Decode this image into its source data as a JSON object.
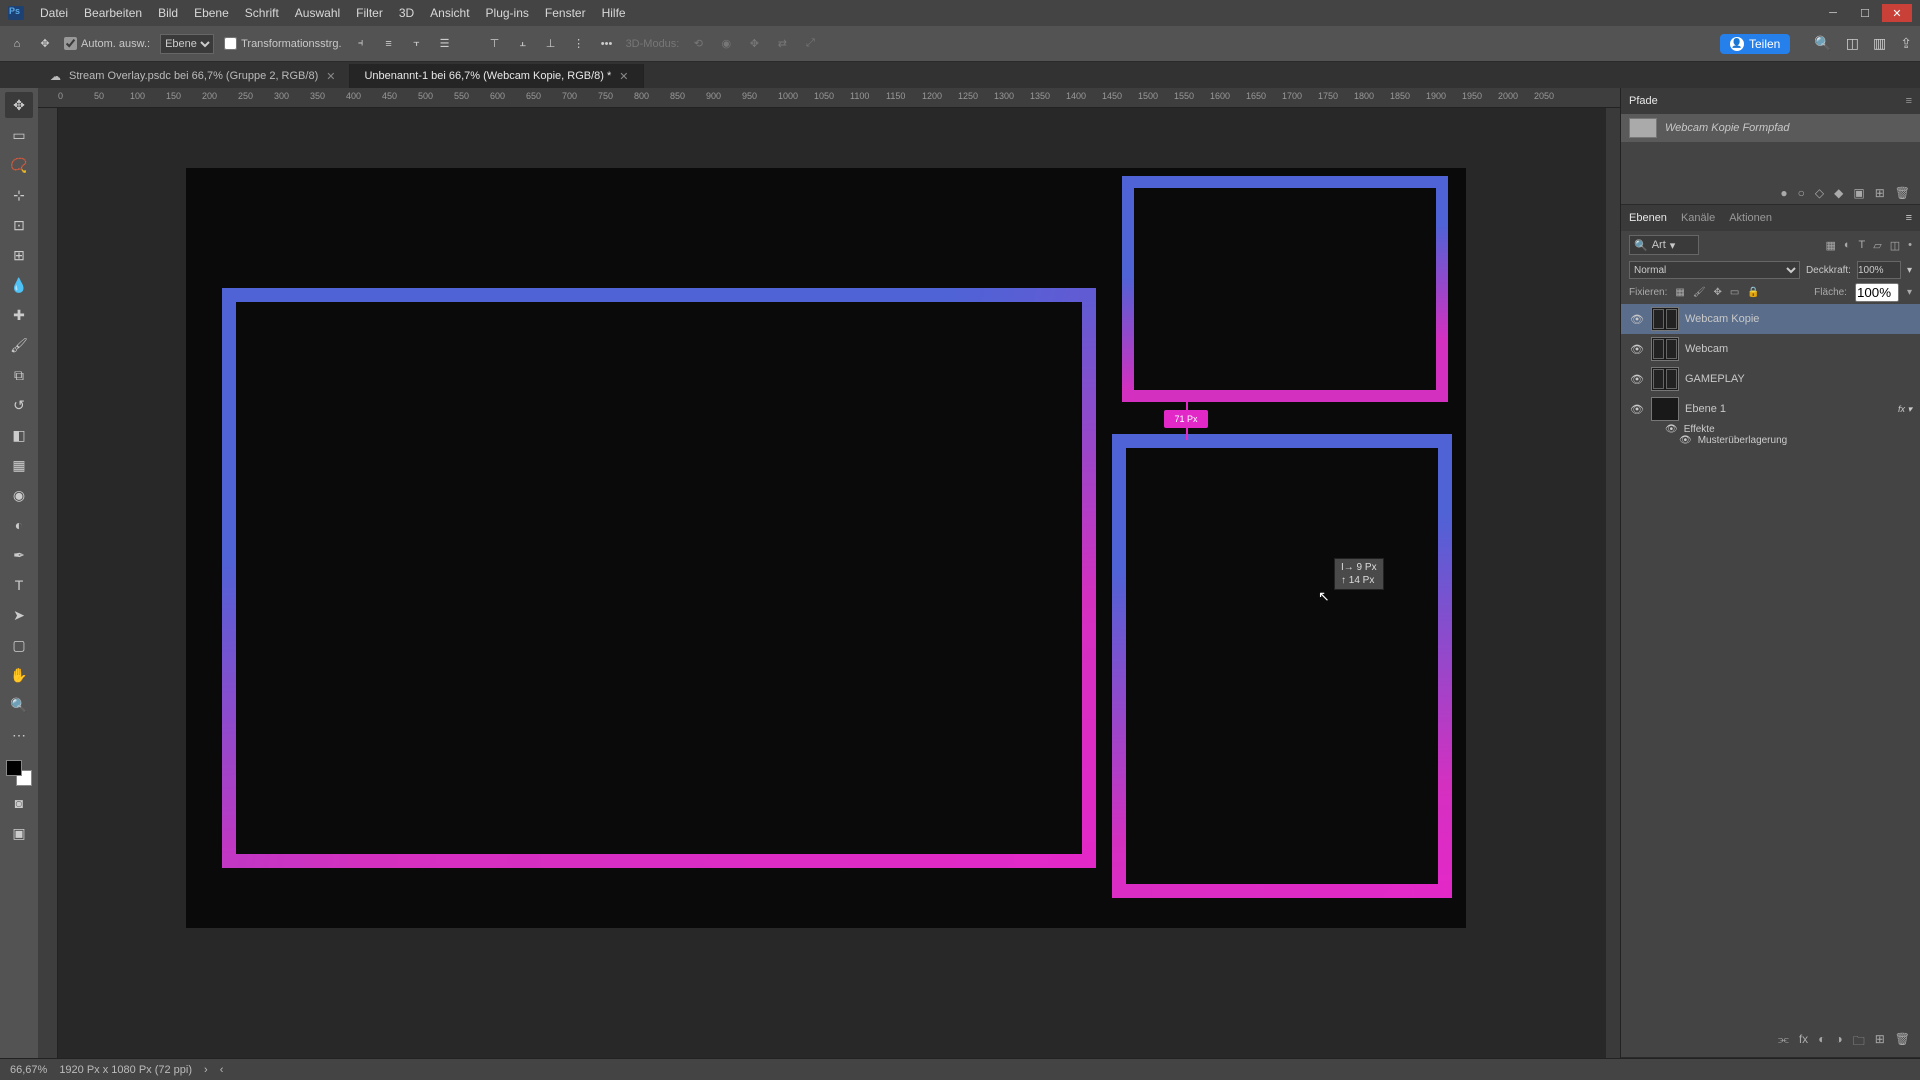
{
  "menu": {
    "items": [
      "Datei",
      "Bearbeiten",
      "Bild",
      "Ebene",
      "Schrift",
      "Auswahl",
      "Filter",
      "3D",
      "Ansicht",
      "Plug-ins",
      "Fenster",
      "Hilfe"
    ]
  },
  "optbar": {
    "auto_ausw": "Autom. ausw.:",
    "layer_dd": "Ebene",
    "transform": "Transformationsstrg.",
    "mode3d": "3D-Modus:",
    "share": "Teilen"
  },
  "tabs": [
    {
      "label": "Stream Overlay.psdc bei 66,7% (Gruppe 2, RGB/8)",
      "active": false
    },
    {
      "label": "Unbenannt-1 bei 66,7% (Webcam Kopie, RGB/8) *",
      "active": true
    }
  ],
  "ruler_marks": [
    "0",
    "50",
    "100",
    "150",
    "200",
    "250",
    "300",
    "350",
    "400",
    "450",
    "500",
    "550",
    "600",
    "650",
    "700",
    "750",
    "800",
    "850",
    "900",
    "950",
    "1000",
    "1050",
    "1100",
    "1150",
    "1200",
    "1250",
    "1300",
    "1350",
    "1400",
    "1450",
    "1500",
    "1550",
    "1600",
    "1650",
    "1700",
    "1750",
    "1800",
    "1850",
    "1900",
    "1950",
    "2000",
    "2050"
  ],
  "measure": "71 Px",
  "tooltip": {
    "l1": "I→   9 Px",
    "l2": "↑   14 Px"
  },
  "paths": {
    "tab": "Pfade",
    "item": "Webcam Kopie Formpfad"
  },
  "layers_panel": {
    "tabs": [
      "Ebenen",
      "Kanäle",
      "Aktionen"
    ],
    "kind": "Art",
    "blend": "Normal",
    "opacity_label": "Deckkraft:",
    "opacity": "100%",
    "fill_label": "Fläche:",
    "fill": "100%",
    "lock_label": "Fixieren:"
  },
  "layers": [
    {
      "name": "Webcam Kopie",
      "sel": true,
      "shape": true
    },
    {
      "name": "Webcam",
      "sel": false,
      "shape": true
    },
    {
      "name": "GAMEPLAY",
      "sel": false,
      "shape": true
    },
    {
      "name": "Ebene 1",
      "sel": false,
      "shape": false,
      "fx": true
    }
  ],
  "fx": {
    "label": "Effekte",
    "item": "Musterüberlagerung"
  },
  "status": {
    "zoom": "66,67%",
    "dims": "1920 Px x 1080 Px (72 ppi)"
  },
  "chart_data": null
}
